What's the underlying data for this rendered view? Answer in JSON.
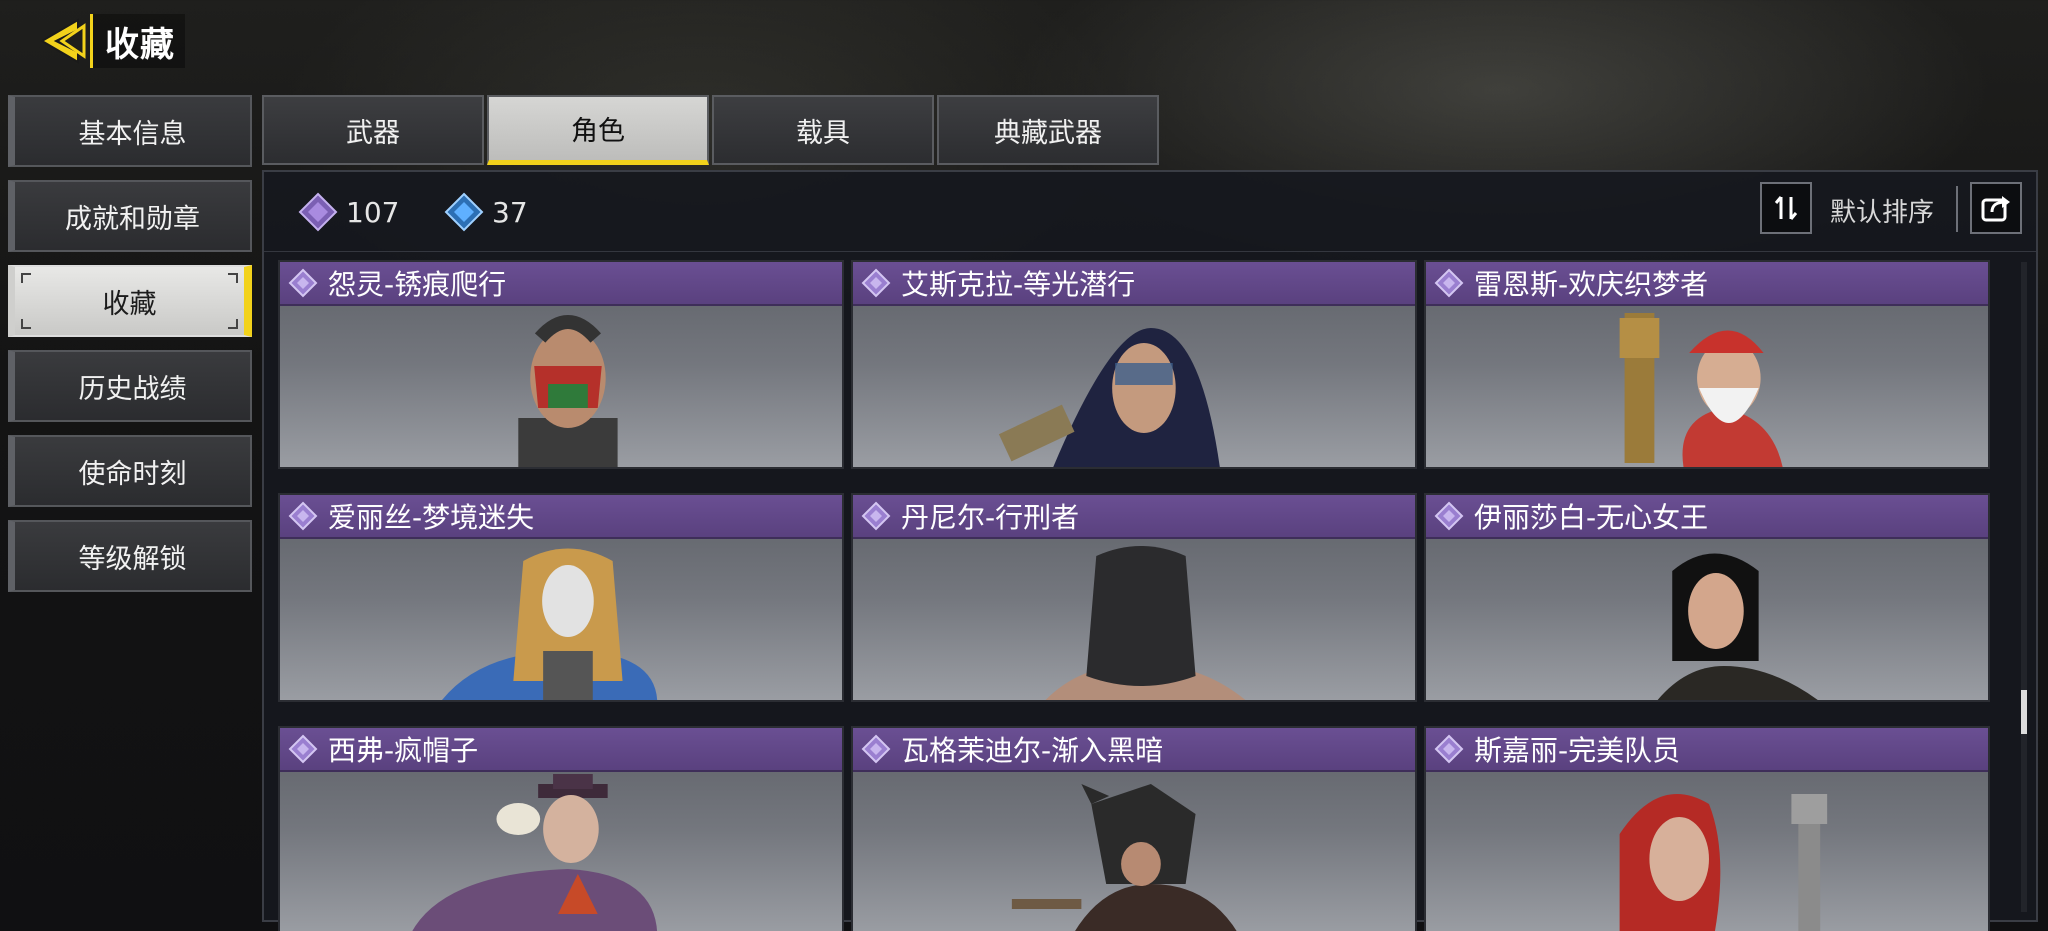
{
  "header": {
    "title": "收藏"
  },
  "sidebar": {
    "items": [
      {
        "label": "基本信息",
        "active": false
      },
      {
        "label": "成就和勋章",
        "active": false
      },
      {
        "label": "收藏",
        "active": true
      },
      {
        "label": "历史战绩",
        "active": false
      },
      {
        "label": "使命时刻",
        "active": false
      },
      {
        "label": "等级解锁",
        "active": false
      }
    ]
  },
  "tabs": [
    {
      "label": "武器",
      "active": false
    },
    {
      "label": "角色",
      "active": true
    },
    {
      "label": "载具",
      "active": false
    },
    {
      "label": "典藏武器",
      "active": false
    }
  ],
  "toolbar": {
    "currency_purple": {
      "value": "107",
      "icon": "purple-diamond-icon",
      "color": "#a98be0"
    },
    "currency_blue": {
      "value": "37",
      "icon": "blue-diamond-icon",
      "color": "#5fb0ff"
    },
    "sort_label": "默认排序"
  },
  "cards": [
    {
      "name": "怨灵-锈痕爬行",
      "rarity_color": "#6a4f93"
    },
    {
      "name": "艾斯克拉-等光潜行",
      "rarity_color": "#6a4f93"
    },
    {
      "name": "雷恩斯-欢庆织梦者",
      "rarity_color": "#6a4f93"
    },
    {
      "name": "爱丽丝-梦境迷失",
      "rarity_color": "#6a4f93"
    },
    {
      "name": "丹尼尔-行刑者",
      "rarity_color": "#6a4f93"
    },
    {
      "name": "伊丽莎白-无心女王",
      "rarity_color": "#6a4f93"
    },
    {
      "name": "西弗-疯帽子",
      "rarity_color": "#6a4f93"
    },
    {
      "name": "瓦格茉迪尔-渐入黑暗",
      "rarity_color": "#6a4f93"
    },
    {
      "name": "斯嘉丽-完美队员",
      "rarity_color": "#6a4f93"
    }
  ],
  "colors": {
    "accent": "#f2d21b",
    "card_header": "#6a4f93"
  }
}
